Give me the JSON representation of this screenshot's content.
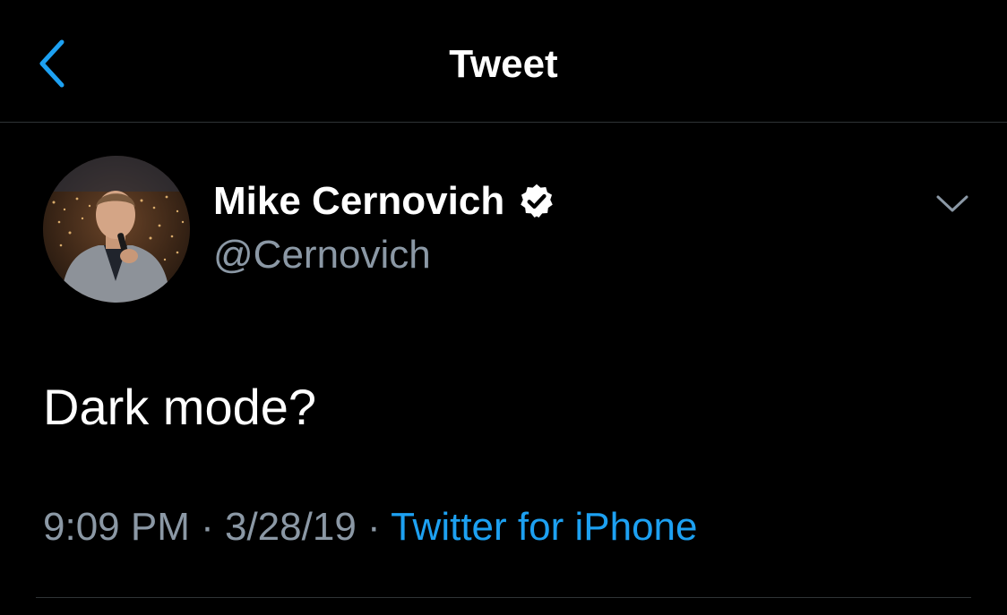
{
  "header": {
    "title": "Tweet",
    "back_icon": "chevron-left-icon"
  },
  "tweet": {
    "author": {
      "name": "Mike Cernovich",
      "handle": "@Cernovich",
      "verified": true,
      "verified_icon": "verified-badge-icon",
      "avatar_icon": "avatar-photo"
    },
    "more_icon": "chevron-down-icon",
    "text": "Dark mode?",
    "time": "9:09 PM",
    "separator_1": " · ",
    "date": "3/28/19",
    "separator_2": " · ",
    "source": "Twitter for iPhone"
  },
  "colors": {
    "background": "#000000",
    "primary_text": "#ffffff",
    "secondary_text": "#8b98a5",
    "accent": "#1da1f2",
    "divider": "#2f3336"
  }
}
